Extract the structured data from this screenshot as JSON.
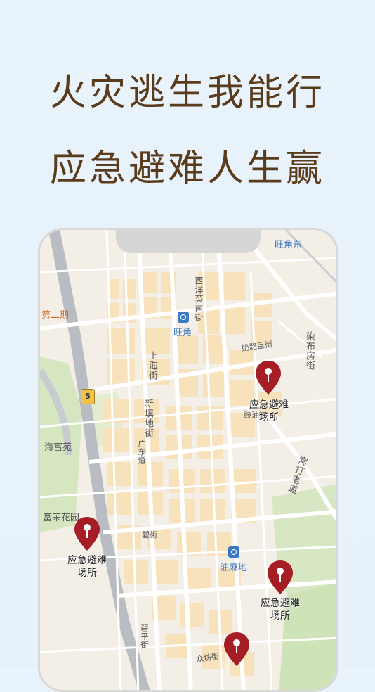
{
  "headline": {
    "line1": "火灾逃生我能行",
    "line2": "应急避难人生赢"
  },
  "map": {
    "labels": {
      "wang_jiao_dong": "旺角东",
      "wang_jiao": "旺角",
      "di_er_qi": "第二期",
      "xi_yang_cai_nan_jie": "西洋菜南街",
      "nai_lu_chen_jie": "奶路臣街",
      "shang_hai_jie": "上海街",
      "xin_tian_di_jie": "新填地街",
      "tu_lu_jie": "豉油街",
      "hai_fu_yuan": "海富苑",
      "guang_dong_dao": "广东道",
      "fu_rong_hua_yuan": "富荣花园",
      "bi_jie": "碧街",
      "you_ma_di": "油麻地",
      "tuo_bu_fang_jie": "染布房街",
      "wa_da_lao_dao": "窝打老道",
      "gong_fang_jie": "众坊街",
      "nuo_ping_jie": "碧平街",
      "route_number": "5"
    },
    "pins": [
      {
        "label_l1": "应急避难",
        "label_l2": "场所"
      },
      {
        "label_l1": "应急避难",
        "label_l2": "场所"
      },
      {
        "label_l1": "应急避难",
        "label_l2": "场所"
      },
      {
        "label_l1": "",
        "label_l2": ""
      }
    ],
    "colors": {
      "pin": "#a51d25",
      "metro": "#3d7ac3",
      "road": "#ffffff",
      "block": "#f6e3bf",
      "park": "#cfe3b8",
      "highway": "#b9bcc2"
    }
  }
}
